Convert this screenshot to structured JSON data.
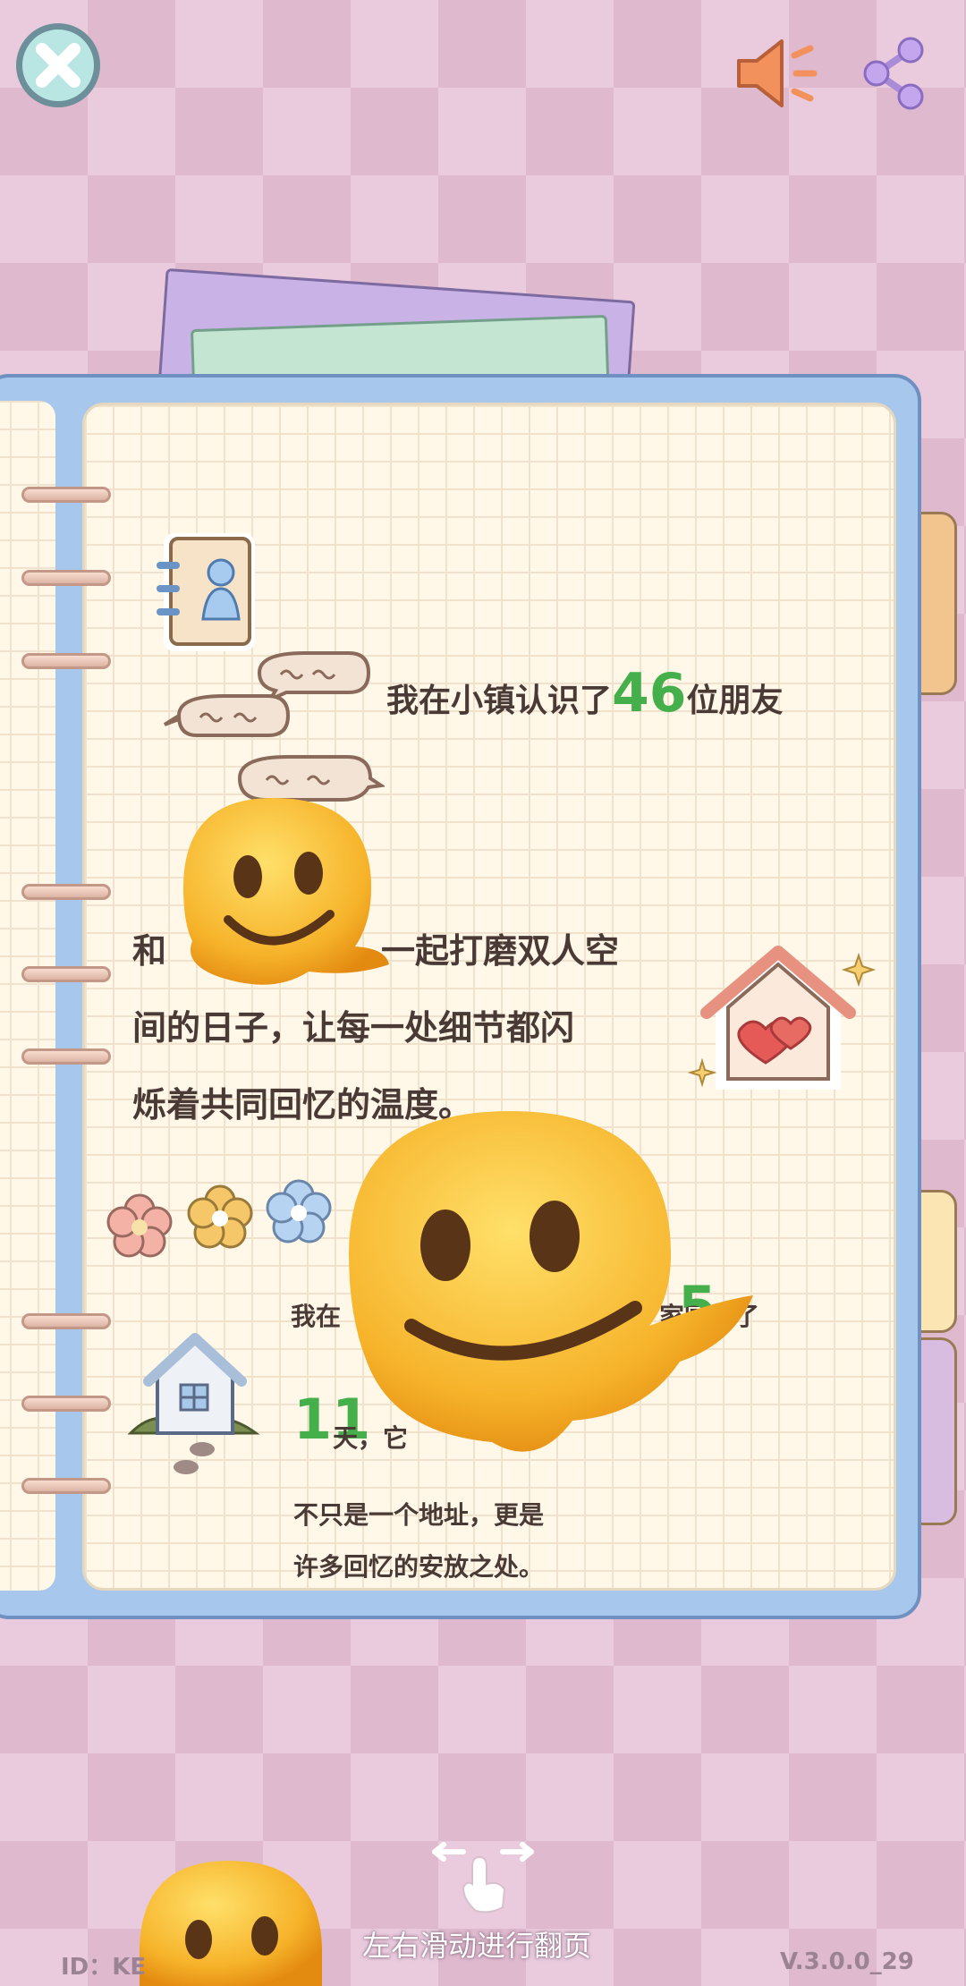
{
  "top_bar": {
    "close_icon": "close-x-icon",
    "sound_icon": "speaker-icon",
    "share_icon": "share-icon"
  },
  "page": {
    "friends_prefix": "我在小镇认识了",
    "friends_count": "46",
    "friends_suffix": "位朋友",
    "couple_line1_start": "和",
    "couple_line1_end": "一起打磨双人空",
    "couple_line2": "间的日子，让每一处细节都闪",
    "couple_line3": "烁着共同回忆的温度。",
    "home_line_start": "我在",
    "home_line_end": "家园待了",
    "home_years": "5",
    "home_days": "11",
    "home_days_suffix": "天，它",
    "home_line4": "不只是一个地址，更是",
    "home_line5": "许多回忆的安放之处。"
  },
  "footer": {
    "swipe_hint": "左右滑动进行翻页",
    "id_label": "ID：KE",
    "version": "V.3.0.0_29"
  },
  "colors": {
    "accent_green": "#45b04b",
    "text_brown": "#4a3a36",
    "notebook_blue": "#a8c7ec"
  }
}
